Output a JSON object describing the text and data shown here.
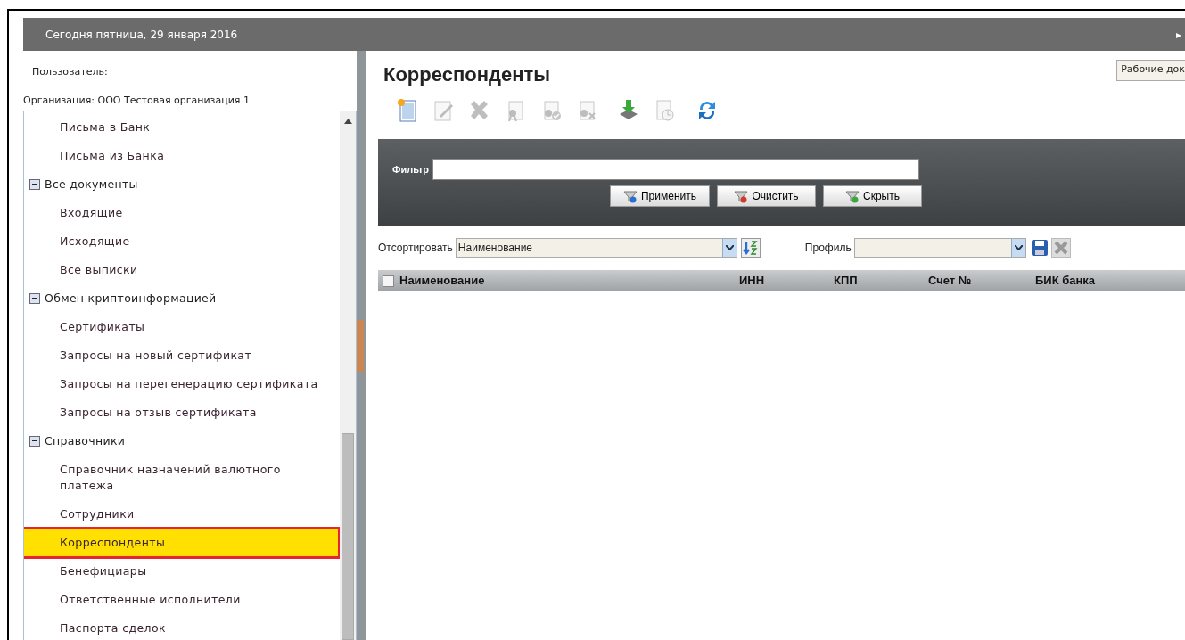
{
  "header": {
    "date": "Сегодня пятница, 29 января 2016",
    "arrow": "▸"
  },
  "sidebar": {
    "user_label": "Пользователь:",
    "organization": "Организация: ООО Тестовая организация 1",
    "tree": [
      {
        "children": [
          {
            "label": "Письма в Банк",
            "selected": false
          },
          {
            "label": "Письма из Банка",
            "selected": false
          }
        ]
      },
      {
        "label": "Все документы",
        "expanded": true,
        "children": [
          {
            "label": "Входящие",
            "selected": false
          },
          {
            "label": "Исходящие",
            "selected": false
          },
          {
            "label": "Все выписки",
            "selected": false
          }
        ]
      },
      {
        "label": "Обмен криптоинформацией",
        "expanded": true,
        "children": [
          {
            "label": "Сертификаты",
            "selected": false
          },
          {
            "label": "Запросы на новый сертификат",
            "selected": false
          },
          {
            "label": "Запросы на перегенерацию сертификата",
            "selected": false
          },
          {
            "label": "Запросы на отзыв сертификата",
            "selected": false
          }
        ]
      },
      {
        "label": "Справочники",
        "expanded": true,
        "children": [
          {
            "label": "Справочник назначений валютного платежа",
            "selected": false
          },
          {
            "label": "Сотрудники",
            "selected": false
          },
          {
            "label": "Корреспонденты",
            "selected": true
          },
          {
            "label": "Бенефициары",
            "selected": false
          },
          {
            "label": "Ответственные исполнители",
            "selected": false
          },
          {
            "label": "Паспорта сделок",
            "selected": false
          }
        ]
      }
    ]
  },
  "main": {
    "title": "Корреспонденты",
    "top_button": "Рабочие док",
    "toolbar": [
      {
        "kind": "new",
        "disabled": false
      },
      {
        "kind": "edit",
        "disabled": true
      },
      {
        "kind": "delete",
        "disabled": true
      },
      {
        "kind": "sign",
        "disabled": true
      },
      {
        "kind": "verify",
        "disabled": true
      },
      {
        "kind": "unsign",
        "disabled": true
      },
      {
        "kind": "import",
        "disabled": false
      },
      {
        "kind": "history",
        "disabled": true
      },
      {
        "kind": "refresh",
        "disabled": false
      }
    ],
    "filter": {
      "label": "Фильтр",
      "buttons": [
        {
          "kind": "apply",
          "label": "Применить"
        },
        {
          "kind": "clear",
          "label": "Очистить"
        },
        {
          "kind": "hide",
          "label": "Скрыть"
        }
      ]
    },
    "sort": {
      "label": "Отсортировать",
      "value": "Наименование"
    },
    "profile": {
      "label": "Профиль"
    },
    "table": {
      "all_checked": false,
      "columns": [
        "Наименование",
        "ИНН",
        "КПП",
        "Счет №",
        "БИК банка"
      ]
    }
  }
}
